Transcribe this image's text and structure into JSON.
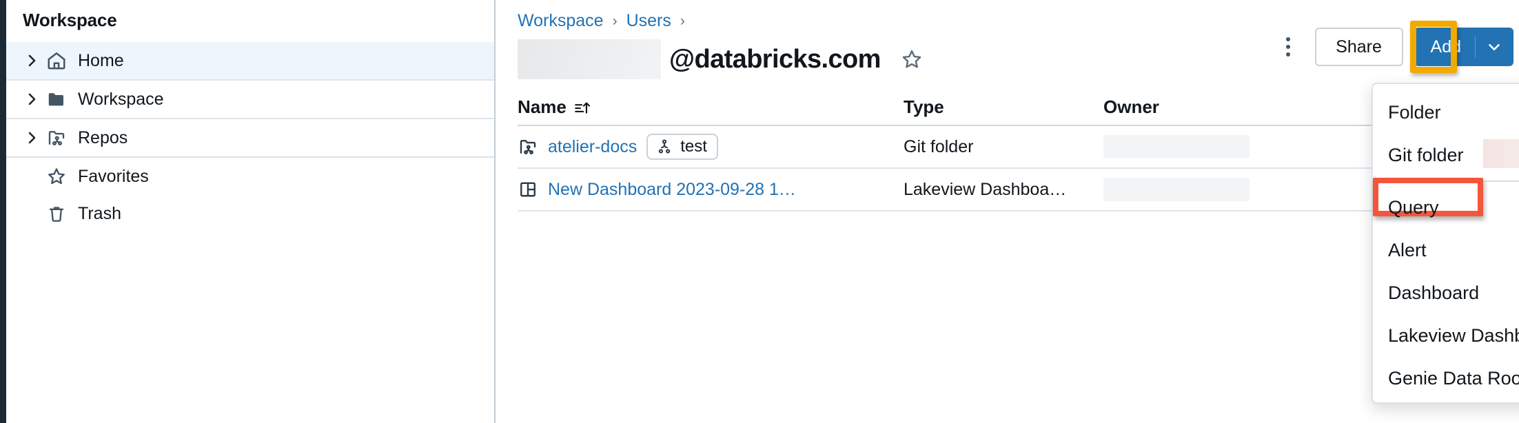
{
  "sidebar": {
    "title": "Workspace",
    "items": [
      {
        "label": "Home",
        "icon": "home-icon",
        "expandable": true,
        "active": true
      },
      {
        "label": "Workspace",
        "icon": "folder-icon",
        "expandable": true,
        "active": false
      },
      {
        "label": "Repos",
        "icon": "repo-icon",
        "expandable": true,
        "active": false
      },
      {
        "label": "Favorites",
        "icon": "star-icon",
        "expandable": false,
        "active": false
      },
      {
        "label": "Trash",
        "icon": "trash-icon",
        "expandable": false,
        "active": false
      }
    ]
  },
  "breadcrumb": {
    "items": [
      "Workspace",
      "Users"
    ],
    "separator": "›",
    "trailing_separator": "›"
  },
  "header": {
    "redacted_prefix": "",
    "title": "@databricks.com",
    "favorite_icon": "star-outline-icon",
    "kebab_icon": "more-vertical-icon",
    "share_label": "Share",
    "add_label": "Add",
    "add_caret_icon": "chevron-down-icon"
  },
  "table": {
    "columns": [
      "Name",
      "Type",
      "Owner"
    ],
    "sort_icon": "sort-ascending-icon",
    "rows": [
      {
        "icon": "git-folder-icon",
        "name": "atelier-docs",
        "branch_badge": {
          "icon": "git-branch-icon",
          "label": "test"
        },
        "type": "Git folder",
        "owner": ""
      },
      {
        "icon": "lakeview-dashboard-icon",
        "name": "New Dashboard 2023-09-28 1…",
        "branch_badge": null,
        "type": "Lakeview Dashboa…",
        "owner": ""
      }
    ]
  },
  "add_menu": {
    "items": [
      {
        "label": "Folder",
        "highlighted": false,
        "separator_after": false
      },
      {
        "label": "Git folder",
        "highlighted": true,
        "separator_after": true
      },
      {
        "label": "Query",
        "highlighted": false,
        "separator_after": false
      },
      {
        "label": "Alert",
        "highlighted": false,
        "separator_after": false
      },
      {
        "label": "Dashboard",
        "highlighted": false,
        "separator_after": false
      },
      {
        "label": "Lakeview Dashboard",
        "highlighted": false,
        "separator_after": false
      },
      {
        "label": "Genie Data Room",
        "highlighted": false,
        "separator_after": false
      }
    ]
  },
  "colors": {
    "link": "#2272b4",
    "primary_button": "#2272b4",
    "annotation_orange": "#f2a900",
    "annotation_red": "#f4563c",
    "sidebar_active": "#eef6fd",
    "rail": "#1b2a35"
  }
}
